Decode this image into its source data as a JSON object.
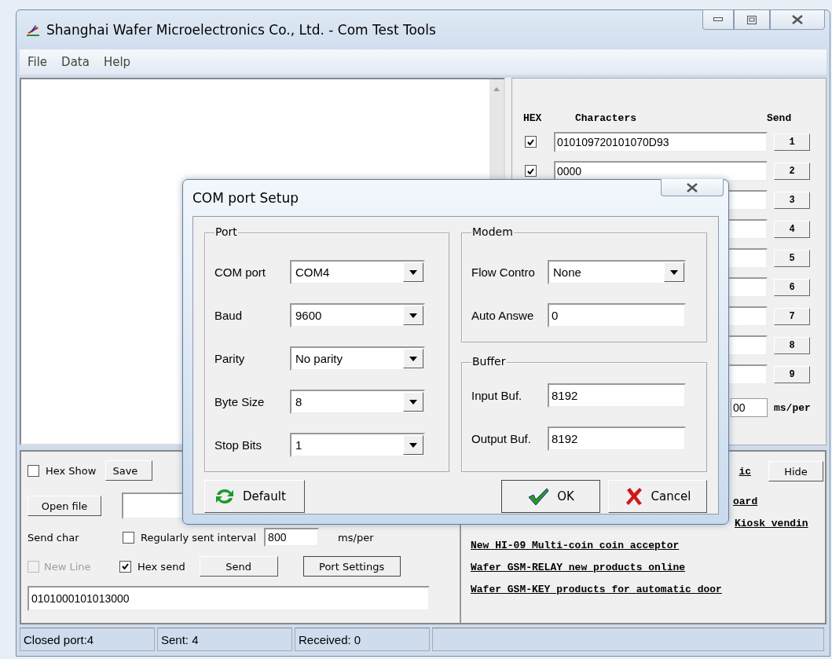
{
  "window": {
    "title": "Shanghai Wafer Microelectronics Co., Ltd. - Com Test Tools"
  },
  "menu": [
    "File",
    "Data",
    "Help"
  ],
  "quick_send": {
    "headers": {
      "hex": "HEX",
      "characters": "Characters",
      "send": "Send"
    },
    "rows": [
      {
        "hex_checked": true,
        "value": "010109720101070D93",
        "button": "1"
      },
      {
        "hex_checked": true,
        "value": "0000",
        "button": "2"
      },
      {
        "button": "3"
      },
      {
        "button": "4"
      },
      {
        "button": "5"
      },
      {
        "button": "6"
      },
      {
        "button": "7"
      },
      {
        "button": "8"
      },
      {
        "button": "9"
      }
    ],
    "interval_value": "00",
    "interval_unit": "ms/per"
  },
  "news": {
    "title": "ic",
    "hide_button": "Hide",
    "links": [
      "oard",
      "Kiosk vendin",
      "New HI-09 Multi-coin coin acceptor",
      "Wafer GSM-RELAY new products online",
      "Wafer GSM-KEY products for automatic door"
    ]
  },
  "controls": {
    "hex_show": {
      "label": "Hex Show",
      "checked": false
    },
    "save_button": "Save",
    "open_file_button": "Open file",
    "send_char_label": "Send char",
    "regular_send": {
      "label": "Regularly sent interval",
      "checked": false
    },
    "interval_value": "800",
    "interval_unit": "ms/per",
    "new_line": {
      "label": "New Line",
      "checked": false,
      "disabled": true
    },
    "hex_send": {
      "label": "Hex send",
      "checked": true,
      "disabled": false
    },
    "send_button": "Send",
    "port_settings_button": "Port Settings",
    "send_text": "0101000101013000"
  },
  "status_bar": [
    "Closed port:4",
    "Sent: 4",
    "Received: 0"
  ],
  "dialog": {
    "title": "COM port Setup",
    "groups": [
      {
        "title": "Port",
        "fields": [
          {
            "kind": "dropdown",
            "label": "COM port",
            "value": "COM4"
          },
          {
            "kind": "dropdown",
            "label": "Baud",
            "value": "9600"
          },
          {
            "kind": "dropdown",
            "label": "Parity",
            "value": "No parity"
          },
          {
            "kind": "dropdown",
            "label": "Byte Size",
            "value": "8"
          },
          {
            "kind": "dropdown",
            "label": "Stop Bits",
            "value": "1"
          }
        ]
      },
      {
        "title": "Modem",
        "fields": [
          {
            "kind": "dropdown",
            "label": "Flow Contro",
            "value": "None"
          },
          {
            "kind": "text",
            "label": "Auto Answe",
            "value": "0"
          }
        ]
      },
      {
        "title": "Buffer",
        "fields": [
          {
            "kind": "text",
            "label": "Input Buf.",
            "value": "8192"
          },
          {
            "kind": "text",
            "label": "Output Buf.",
            "value": "8192"
          }
        ]
      }
    ],
    "buttons": [
      {
        "kind": "default",
        "label": "Default"
      },
      {
        "kind": "ok",
        "label": "OK"
      },
      {
        "kind": "cancel",
        "label": "Cancel"
      }
    ]
  }
}
